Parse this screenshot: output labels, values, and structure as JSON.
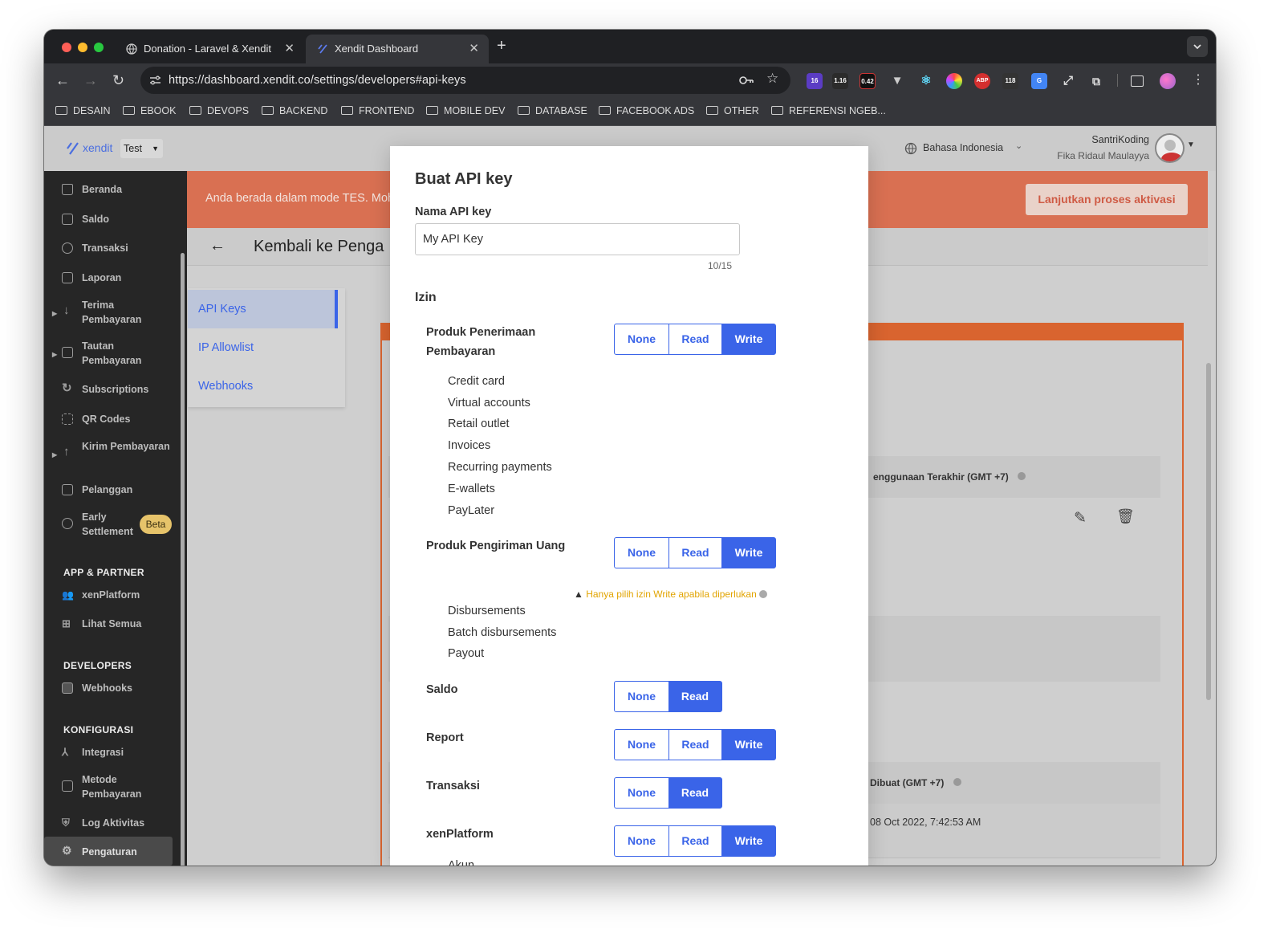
{
  "browser": {
    "tabs": [
      {
        "title": "Donation - Laravel & Xendit"
      },
      {
        "title": "Xendit Dashboard"
      }
    ],
    "url": "https://dashboard.xendit.co/settings/developers#api-keys",
    "extensions": [
      "16",
      "1.16",
      "0.42",
      "118"
    ],
    "bookmarks": [
      "DESAIN",
      "EBOOK",
      "DEVOPS",
      "BACKEND",
      "FRONTEND",
      "MOBILE DEV",
      "DATABASE",
      "FACEBOOK ADS",
      "OTHER",
      "REFERENSI NGEB..."
    ]
  },
  "header": {
    "logo": "xendit",
    "mode": "Test",
    "language": "Bahasa Indonesia",
    "business": "SantriKoding",
    "user": "Fika Ridaul Maulayya"
  },
  "sidebar": {
    "items": [
      "Beranda",
      "Saldo",
      "Transaksi",
      "Laporan",
      "Terima Pembayaran",
      "Tautan Pembayaran",
      "Subscriptions",
      "QR Codes",
      "Kirim Pembayaran",
      "Pelanggan",
      "Early Settlement"
    ],
    "beta": "Beta",
    "sections": [
      {
        "title": "APP & PARTNER",
        "items": [
          "xenPlatform",
          "Lihat Semua"
        ]
      },
      {
        "title": "DEVELOPERS",
        "items": [
          "Webhooks"
        ]
      },
      {
        "title": "KONFIGURASI",
        "items": [
          "Integrasi",
          "Metode Pembayaran",
          "Log Aktivitas",
          "Pengaturan"
        ]
      }
    ]
  },
  "banner": {
    "text": "Anda berada dalam mode TES. Moh",
    "button": "Lanjutkan proses aktivasi"
  },
  "page": {
    "back": "Kembali ke Penga",
    "subnav": [
      "API Keys",
      "IP Allowlist",
      "Webhooks"
    ]
  },
  "background_table": {
    "col_last_used": "enggunaan Terakhir (GMT +7)",
    "col_created": "Dibuat (GMT +7)",
    "created_value": "08 Oct 2022, 7:42:53 AM"
  },
  "modal": {
    "title": "Buat API key",
    "name_label": "Nama API key",
    "name_value": "My API Key",
    "counter": "10/15",
    "perm_label": "Izin",
    "labels": {
      "none": "None",
      "read": "Read",
      "write": "Write"
    },
    "warning": "Hanya pilih izin Write apabila diperlukan",
    "permissions": [
      {
        "title": "Produk Penerimaan Pembayaran",
        "selected": "Write",
        "items": [
          "Credit card",
          "Virtual accounts",
          "Retail outlet",
          "Invoices",
          "Recurring payments",
          "E-wallets",
          "PayLater"
        ]
      },
      {
        "title": "Produk Pengiriman Uang",
        "selected": "Write",
        "items": [
          "Disbursements",
          "Batch disbursements",
          "Payout"
        ]
      },
      {
        "title": "Saldo",
        "selected": "Read",
        "items": []
      },
      {
        "title": "Report",
        "selected": "Write",
        "items": []
      },
      {
        "title": "Transaksi",
        "selected": "Read",
        "items": []
      },
      {
        "title": "xenPlatform",
        "selected": "Write",
        "items": [
          "Akun"
        ]
      }
    ]
  },
  "colors": {
    "accent": "#3a64e8",
    "banner": "#e36b3d",
    "warning": "#e2a400",
    "sidebar": "#262626"
  }
}
